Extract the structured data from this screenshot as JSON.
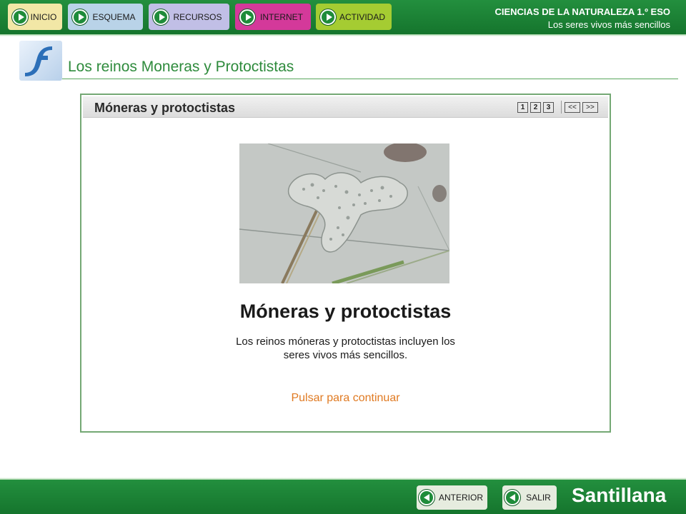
{
  "nav": {
    "items": [
      {
        "label": "INICIO"
      },
      {
        "label": "ESQUEMA"
      },
      {
        "label": "RECURSOS"
      },
      {
        "label": "INTERNET"
      },
      {
        "label": "ACTIVIDAD"
      }
    ]
  },
  "course": {
    "title": "CIENCIAS DE LA NATURALEZA 1.º ESO",
    "subtitle": "Los seres vivos más sencillos"
  },
  "page": {
    "title": "Los reinos Moneras y Protoctistas"
  },
  "slide": {
    "header_title": "Móneras y protoctistas",
    "pager": [
      "1",
      "2",
      "3"
    ],
    "prev_label": "<<",
    "next_label": ">>",
    "heading": "Móneras y protoctistas",
    "description": "Los reinos móneras y protoctistas incluyen los\nseres vivos más sencillos.",
    "continue_label": "Pulsar para continuar"
  },
  "footer": {
    "anterior_label": "ANTERIOR",
    "salir_label": "SALIR",
    "brand": "Santillana"
  },
  "colors": {
    "bar_green": "#1e8a3a",
    "title_green": "#2e8b3c",
    "continue_orange": "#e07a22",
    "inicio": "#f2e7a6",
    "esquema": "#b9d3e8",
    "recursos": "#c1bfe6",
    "internet": "#d4399a",
    "actividad": "#a5cc32"
  }
}
